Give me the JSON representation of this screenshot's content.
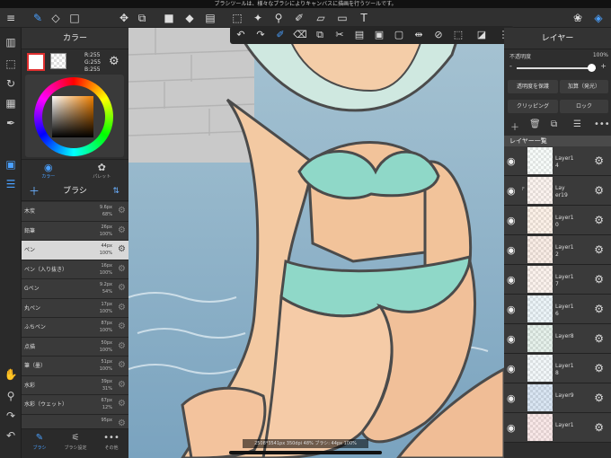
{
  "statusbar": {
    "text": "ブラシツールは、様々なブラシによりキャンバスに描画を行うツールです。"
  },
  "colors": {
    "accent": "#4aa0ff",
    "panel": "#2e2e2e",
    "selected_row": "#d8d8d8",
    "main_color": "#ffffff"
  },
  "toolbar": {
    "left_icons": [
      "menu-icon",
      "brush-tool-icon",
      "eraser-tool-icon",
      "rectangle-select-icon",
      "move-icon",
      "transform-icon",
      "fill-rect-icon",
      "bucket-icon",
      "gradient-icon",
      "lasso-icon",
      "magic-wand-icon",
      "eyedropper-icon",
      "select-pen-icon",
      "text-icon"
    ],
    "right_icons": [
      "materials-icon",
      "layers-icon"
    ]
  },
  "color_panel": {
    "title": "カラー",
    "rgb": {
      "r": "R:255",
      "g": "G:255",
      "b": "B:255"
    },
    "tabs": [
      {
        "label": "カラー",
        "icon": "color-wheel-icon"
      },
      {
        "label": "パレット",
        "icon": "palette-icon"
      }
    ]
  },
  "brush_panel": {
    "title": "ブラシ",
    "brushes": [
      {
        "name": "木炭",
        "size": "9.6px",
        "opacity": "68%"
      },
      {
        "name": "鉛筆",
        "size": "26px",
        "opacity": "100%"
      },
      {
        "name": "ペン",
        "size": "44px",
        "opacity": "100%",
        "selected": true
      },
      {
        "name": "ペン（入り抜き）",
        "size": "16px",
        "opacity": "100%"
      },
      {
        "name": "Gペン",
        "size": "9.2px",
        "opacity": "54%"
      },
      {
        "name": "丸ペン",
        "size": "17px",
        "opacity": "100%"
      },
      {
        "name": "ふちペン",
        "size": "87px",
        "opacity": "100%"
      },
      {
        "name": "点描",
        "size": "50px",
        "opacity": "100%"
      },
      {
        "name": "筆（墨）",
        "size": "51px",
        "opacity": "100%"
      },
      {
        "name": "水彩",
        "size": "39px",
        "opacity": "31%"
      },
      {
        "name": "水彩（ウェット）",
        "size": "67px",
        "opacity": "12%"
      },
      {
        "name": "",
        "size": "95px",
        "opacity": ""
      }
    ],
    "tabs": [
      {
        "label": "ブラシ",
        "active": true
      },
      {
        "label": "ブラシ設定"
      },
      {
        "label": "その他"
      }
    ]
  },
  "canvas": {
    "info": "2508*3541px 350dpi 48% ブラシ: 44px 100%"
  },
  "layer_panel": {
    "title": "レイヤー",
    "opacity_label": "不透明度",
    "opacity_value": "100%",
    "protect_label": "透明度を保護",
    "blend_label": "加算（発光）",
    "clipping_label": "クリッピング",
    "lock_label": "ロック",
    "list_title": "レイヤー一覧",
    "layers": [
      {
        "name": "Layer1\n4",
        "prefix": ""
      },
      {
        "name": "Lay\ner19",
        "prefix": "F"
      },
      {
        "name": "Layer1\n0",
        "prefix": ""
      },
      {
        "name": "Layer1\n2",
        "prefix": ""
      },
      {
        "name": "Layer1\n7",
        "prefix": ""
      },
      {
        "name": "Layer1\n6",
        "prefix": ""
      },
      {
        "name": "Layer8",
        "prefix": ""
      },
      {
        "name": "Layer1\n8",
        "prefix": ""
      },
      {
        "name": "Layer9",
        "prefix": ""
      },
      {
        "name": "Layer1",
        "prefix": ""
      }
    ]
  }
}
